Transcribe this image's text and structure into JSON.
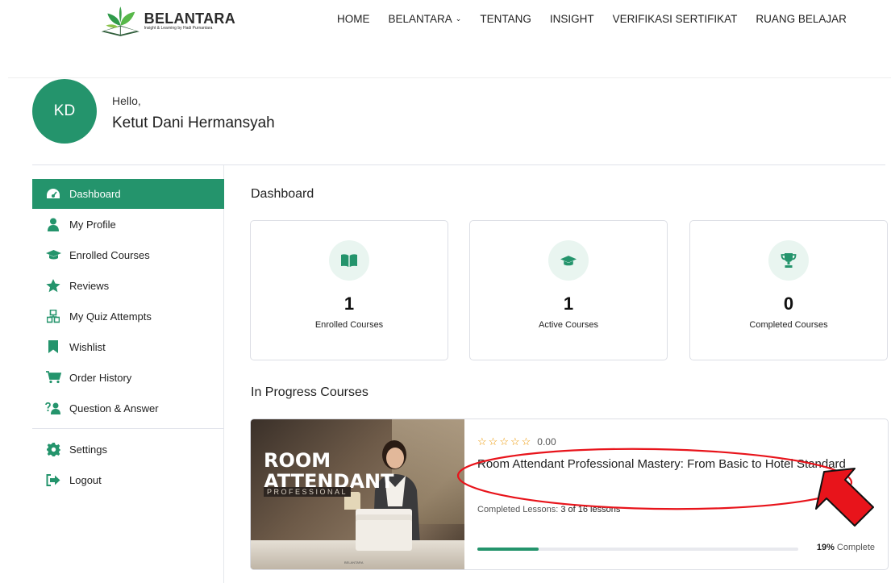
{
  "brand": {
    "name": "BELANTARA",
    "tagline": "Insight & Learning by Hadi Purnantara"
  },
  "nav": {
    "items": [
      "HOME",
      "BELANTARA",
      "TENTANG",
      "INSIGHT",
      "VERIFIKASI SERTIFIKAT",
      "RUANG BELAJAR"
    ],
    "dropdown_chevron": "⌄"
  },
  "profile": {
    "initials": "KD",
    "greeting": "Hello,",
    "name": "Ketut Dani Hermansyah"
  },
  "sidebar": {
    "items": [
      {
        "label": "Dashboard",
        "icon": "dashboard-icon",
        "active": true
      },
      {
        "label": "My Profile",
        "icon": "user-icon"
      },
      {
        "label": "Enrolled Courses",
        "icon": "graduation-cap-icon"
      },
      {
        "label": "Reviews",
        "icon": "star-icon"
      },
      {
        "label": "My Quiz Attempts",
        "icon": "quiz-icon"
      },
      {
        "label": "Wishlist",
        "icon": "bookmark-icon"
      },
      {
        "label": "Order History",
        "icon": "cart-icon"
      },
      {
        "label": "Question & Answer",
        "icon": "question-answer-icon"
      }
    ],
    "bottom_items": [
      {
        "label": "Settings",
        "icon": "gear-icon"
      },
      {
        "label": "Logout",
        "icon": "logout-icon"
      }
    ]
  },
  "main": {
    "title": "Dashboard",
    "stats": [
      {
        "value": "1",
        "label": "Enrolled Courses",
        "icon": "book-icon"
      },
      {
        "value": "1",
        "label": "Active Courses",
        "icon": "graduation-cap-icon"
      },
      {
        "value": "0",
        "label": "Completed Courses",
        "icon": "trophy-icon"
      }
    ],
    "in_progress_title": "In Progress Courses",
    "course": {
      "thumb_line1": "ROOM",
      "thumb_line2": "ATTENDANT",
      "thumb_line3": "PROFESSIONAL",
      "thumb_brand": "BELANTARA",
      "rating": "0.00",
      "stars": 0,
      "title": "Room Attendant Professional Mastery: From Basic to Hotel Standard",
      "lessons_label": "Completed Lessons:",
      "lessons_value": "3 of 16 lessons",
      "progress_percent": 19,
      "progress_value": "19%",
      "progress_suffix": "Complete"
    }
  },
  "colors": {
    "accent": "#24946c",
    "annotation": "#e8141b"
  }
}
